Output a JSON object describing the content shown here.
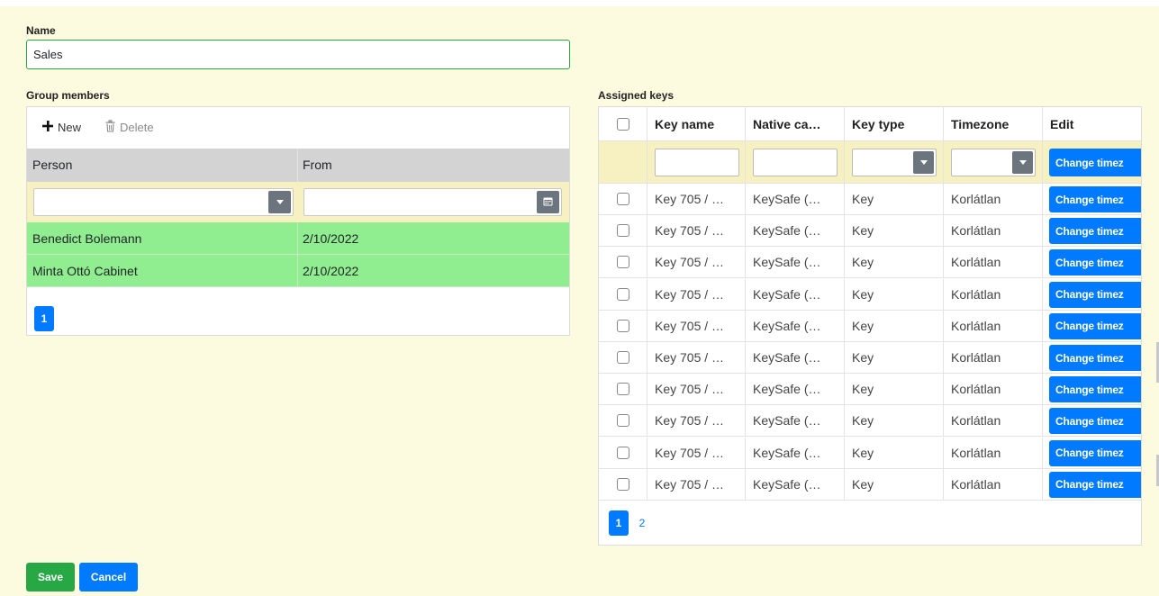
{
  "form": {
    "name_label": "Name",
    "name_value": "Sales"
  },
  "group_members": {
    "title": "Group members",
    "toolbar": {
      "new_label": "New",
      "delete_label": "Delete"
    },
    "columns": [
      "Person",
      "From"
    ],
    "rows": [
      {
        "person": "Benedict Bolemann",
        "from": "2/10/2022"
      },
      {
        "person": "Minta Ottó Cabinet",
        "from": "2/10/2022"
      }
    ],
    "row_color": "#90ee90",
    "pagination": {
      "pages": [
        "1"
      ],
      "current": "1"
    }
  },
  "assigned_keys": {
    "title": "Assigned keys",
    "columns": [
      "Key name",
      "Native ca…",
      "Key type",
      "Timezone",
      "Edit"
    ],
    "filter_button": "Change timez",
    "rows": [
      {
        "key_name": "Key 705 / …",
        "native": "KeySafe (…",
        "key_type": "Key",
        "timezone": "Korlátlan",
        "edit": "Change timez"
      },
      {
        "key_name": "Key 705 / …",
        "native": "KeySafe (…",
        "key_type": "Key",
        "timezone": "Korlátlan",
        "edit": "Change timez"
      },
      {
        "key_name": "Key 705 / …",
        "native": "KeySafe (…",
        "key_type": "Key",
        "timezone": "Korlátlan",
        "edit": "Change timez"
      },
      {
        "key_name": "Key 705 / …",
        "native": "KeySafe (…",
        "key_type": "Key",
        "timezone": "Korlátlan",
        "edit": "Change timez"
      },
      {
        "key_name": "Key 705 / …",
        "native": "KeySafe (…",
        "key_type": "Key",
        "timezone": "Korlátlan",
        "edit": "Change timez"
      },
      {
        "key_name": "Key 705 / …",
        "native": "KeySafe (…",
        "key_type": "Key",
        "timezone": "Korlátlan",
        "edit": "Change timez"
      },
      {
        "key_name": "Key 705 / …",
        "native": "KeySafe (…",
        "key_type": "Key",
        "timezone": "Korlátlan",
        "edit": "Change timez"
      },
      {
        "key_name": "Key 705 / …",
        "native": "KeySafe (…",
        "key_type": "Key",
        "timezone": "Korlátlan",
        "edit": "Change timez"
      },
      {
        "key_name": "Key 705 / …",
        "native": "KeySafe (…",
        "key_type": "Key",
        "timezone": "Korlátlan",
        "edit": "Change timez"
      },
      {
        "key_name": "Key 705 / …",
        "native": "KeySafe (…",
        "key_type": "Key",
        "timezone": "Korlátlan",
        "edit": "Change timez"
      }
    ],
    "pagination": {
      "pages": [
        "1",
        "2"
      ],
      "current": "1"
    }
  },
  "actions": {
    "save_label": "Save",
    "cancel_label": "Cancel"
  },
  "colors": {
    "background": "#fcfbe0",
    "filter_row": "#f7f1c2",
    "primary": "#007bff",
    "success": "#28a745",
    "header_gray": "#d3d3d3"
  }
}
